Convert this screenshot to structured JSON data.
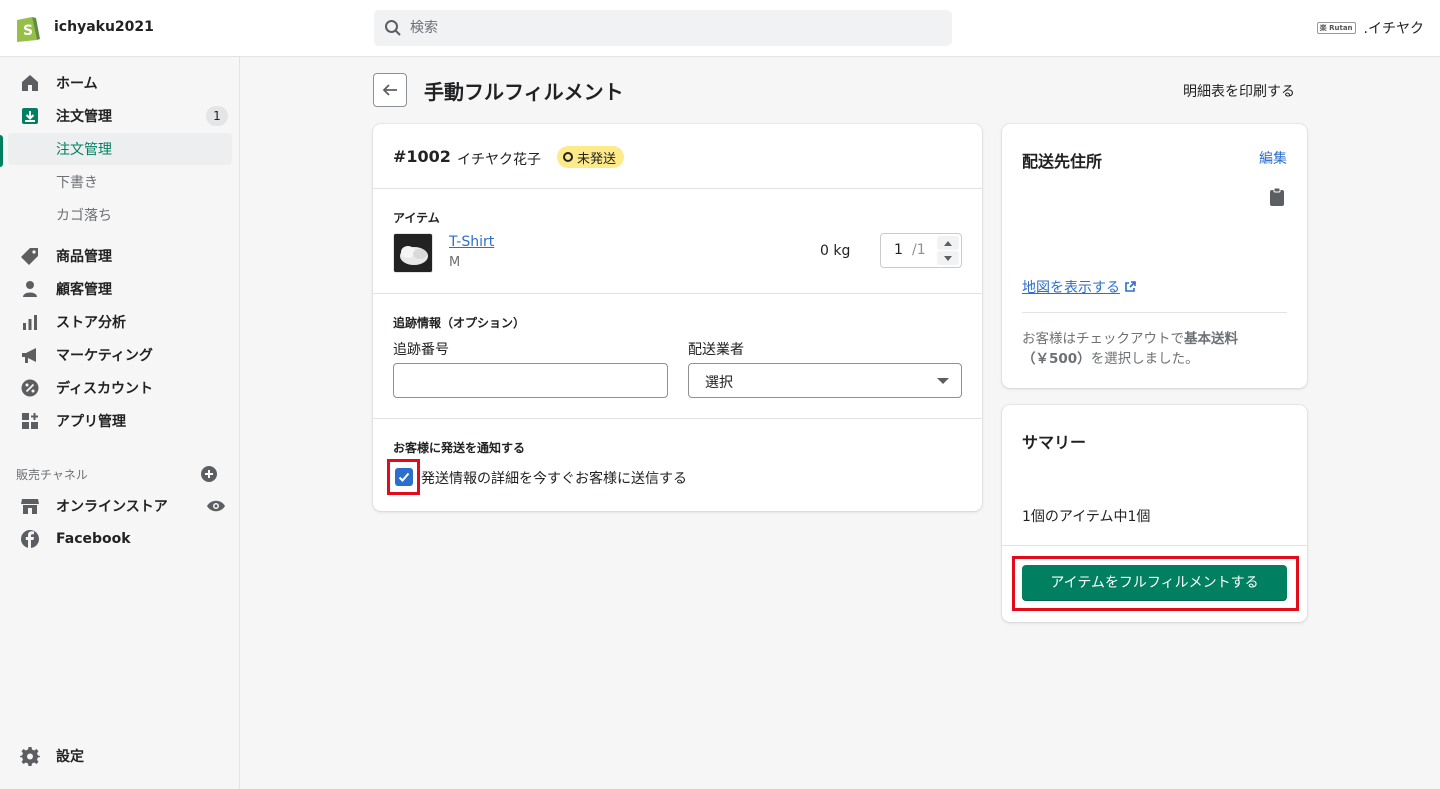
{
  "topbar": {
    "store_name": "ichyaku2021",
    "search_placeholder": "検索",
    "mini_logo": "楽 Rutan",
    "account_name": ".イチヤク"
  },
  "sidebar": {
    "items": [
      {
        "label": "ホーム"
      },
      {
        "label": "注文管理",
        "count": "1"
      },
      {
        "label": "注文管理"
      },
      {
        "label": "下書き"
      },
      {
        "label": "カゴ落ち"
      },
      {
        "label": "商品管理"
      },
      {
        "label": "顧客管理"
      },
      {
        "label": "ストア分析"
      },
      {
        "label": "マーケティング"
      },
      {
        "label": "ディスカウント"
      },
      {
        "label": "アプリ管理"
      }
    ],
    "channels_title": "販売チャネル",
    "channels": [
      {
        "label": "オンラインストア"
      },
      {
        "label": "Facebook"
      }
    ],
    "settings_label": "設定"
  },
  "page": {
    "title": "手動フルフィルメント",
    "print_label": "明細表を印刷する"
  },
  "order": {
    "number": "#1002",
    "customer": "イチヤク花子",
    "status": "未発送",
    "status_color": "#ffea8a"
  },
  "items_section": {
    "title": "アイテム",
    "item_name": "T-Shirt",
    "variant": "M",
    "weight": "0 kg",
    "quantity": "1",
    "quantity_total": "/1"
  },
  "tracking": {
    "title": "追跡情報（オプション）",
    "number_label": "追跡番号",
    "number_value": "",
    "carrier_label": "配送業者",
    "carrier_value": "選択"
  },
  "notify": {
    "title": "お客様に発送を通知する",
    "checkbox_label": "発送情報の詳細を今すぐお客様に送信する",
    "checked": true
  },
  "address": {
    "title": "配送先住所",
    "edit_label": "編集",
    "map_label": "地図を表示する",
    "note_prefix": "お客様はチェックアウトで",
    "note_bold": "基本送料（￥500）",
    "note_suffix": "を選択しました。"
  },
  "summary": {
    "title": "サマリー",
    "count_text": "1個のアイテム中1個",
    "button_label": "アイテムをフルフィルメントする"
  },
  "colors": {
    "primary": "#008060",
    "link": "#2c6ecb",
    "highlight": "#e30b1a"
  }
}
